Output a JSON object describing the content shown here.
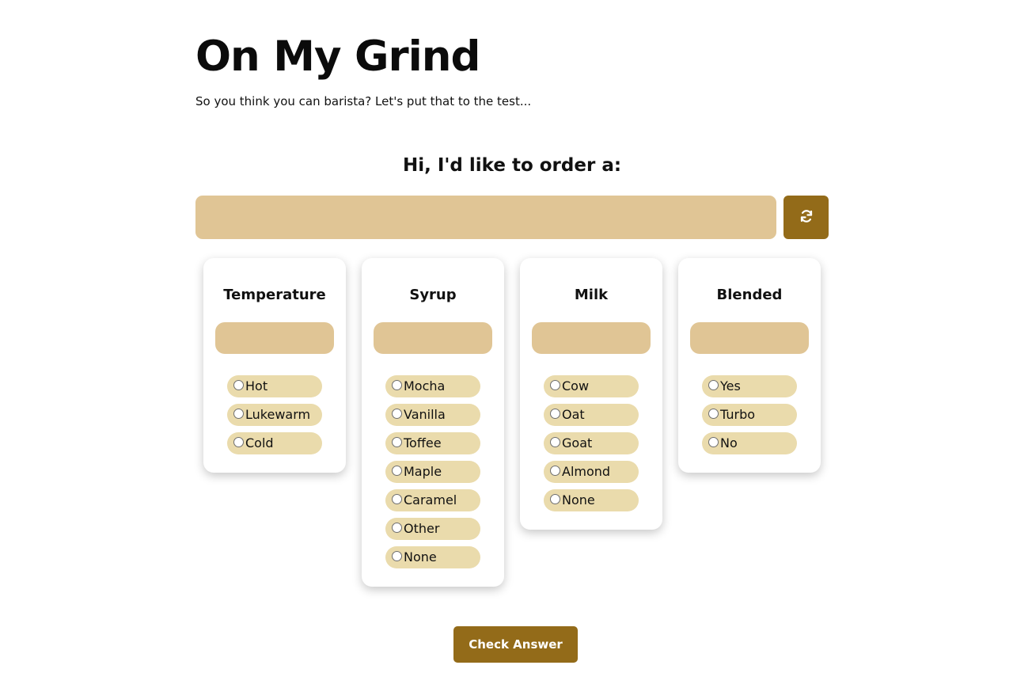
{
  "header": {
    "title": "On My Grind",
    "subtitle": "So you think you can barista? Let's put that to the test..."
  },
  "order": {
    "prompt": "Hi, I'd like to order a:",
    "current_order": "",
    "refresh_icon": "refresh-icon"
  },
  "categories": [
    {
      "title": "Temperature",
      "selected": "",
      "options": [
        "Hot",
        "Lukewarm",
        "Cold"
      ]
    },
    {
      "title": "Syrup",
      "selected": "",
      "options": [
        "Mocha",
        "Vanilla",
        "Toffee",
        "Maple",
        "Caramel",
        "Other",
        "None"
      ]
    },
    {
      "title": "Milk",
      "selected": "",
      "options": [
        "Cow",
        "Oat",
        "Goat",
        "Almond",
        "None"
      ]
    },
    {
      "title": "Blended",
      "selected": "",
      "options": [
        "Yes",
        "Turbo",
        "No"
      ]
    }
  ],
  "actions": {
    "check_label": "Check Answer"
  },
  "colors": {
    "accent": "#936b19",
    "slot": "#e0c595",
    "option_bg": "#eadbac",
    "card_bg": "#ffffff"
  }
}
